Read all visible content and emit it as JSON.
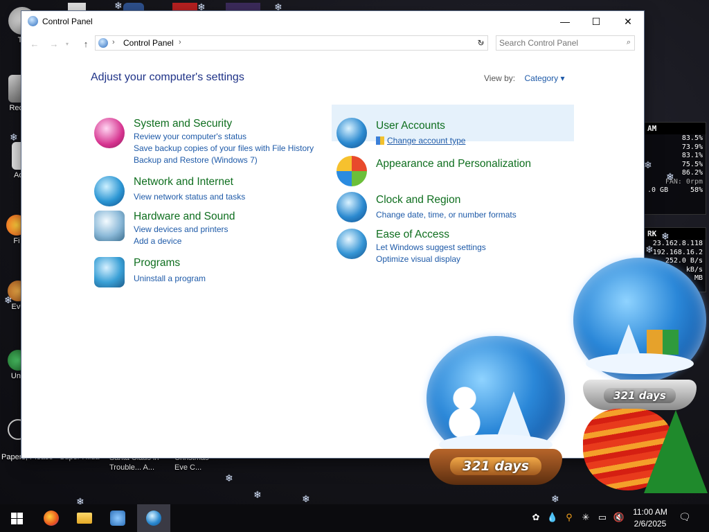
{
  "window": {
    "title": "Control Panel",
    "minimize": "—",
    "maximize": "☐",
    "close": "✕"
  },
  "address": {
    "crumb": "Control Panel",
    "search_placeholder": "Search Control Panel"
  },
  "content": {
    "heading": "Adjust your computer's settings",
    "view_by_label": "View by:",
    "view_by_value": "Category"
  },
  "categories_left": [
    {
      "title": "System and Security",
      "links": [
        "Review your computer's status",
        "Save backup copies of your files with File History",
        "Backup and Restore (Windows 7)"
      ]
    },
    {
      "title": "Network and Internet",
      "links": [
        "View network status and tasks"
      ]
    },
    {
      "title": "Hardware and Sound",
      "links": [
        "View devices and printers",
        "Add a device"
      ]
    },
    {
      "title": "Programs",
      "links": [
        "Uninstall a program"
      ]
    }
  ],
  "categories_right": [
    {
      "title": "User Accounts",
      "links": [
        "Change account type"
      ]
    },
    {
      "title": "Appearance and Personalization",
      "links": []
    },
    {
      "title": "Clock and Region",
      "links": [
        "Change date, time, or number formats"
      ]
    },
    {
      "title": "Ease of Access",
      "links": [
        "Let Windows suggest settings",
        "Optimize visual display"
      ]
    }
  ],
  "desktop": {
    "icon_labels": [
      "Th",
      "Recy",
      "Act",
      "Fi",
      "Eve",
      "Und",
      "Papers, Please",
      "Super Hilda",
      "Santa Claus in Trouble... A...",
      "Christmas Eve C..."
    ]
  },
  "gadget": {
    "mem_title": "AM",
    "mem_values": [
      "83.5%",
      "73.9%",
      "83.1%",
      "75.5%",
      "86.2%",
      "FAN: 0rpm",
      ".0 GB",
      "58%"
    ],
    "net_title": "RK",
    "net_values": [
      "23.162.8.118",
      "192.168.16.2",
      "252.0 B/s",
      "kB/s",
      "MB"
    ]
  },
  "globes": {
    "left_days": "321 days",
    "right_days": "321 days"
  },
  "taskbar": {
    "time": "11:00 AM",
    "date": "2/6/2025"
  }
}
